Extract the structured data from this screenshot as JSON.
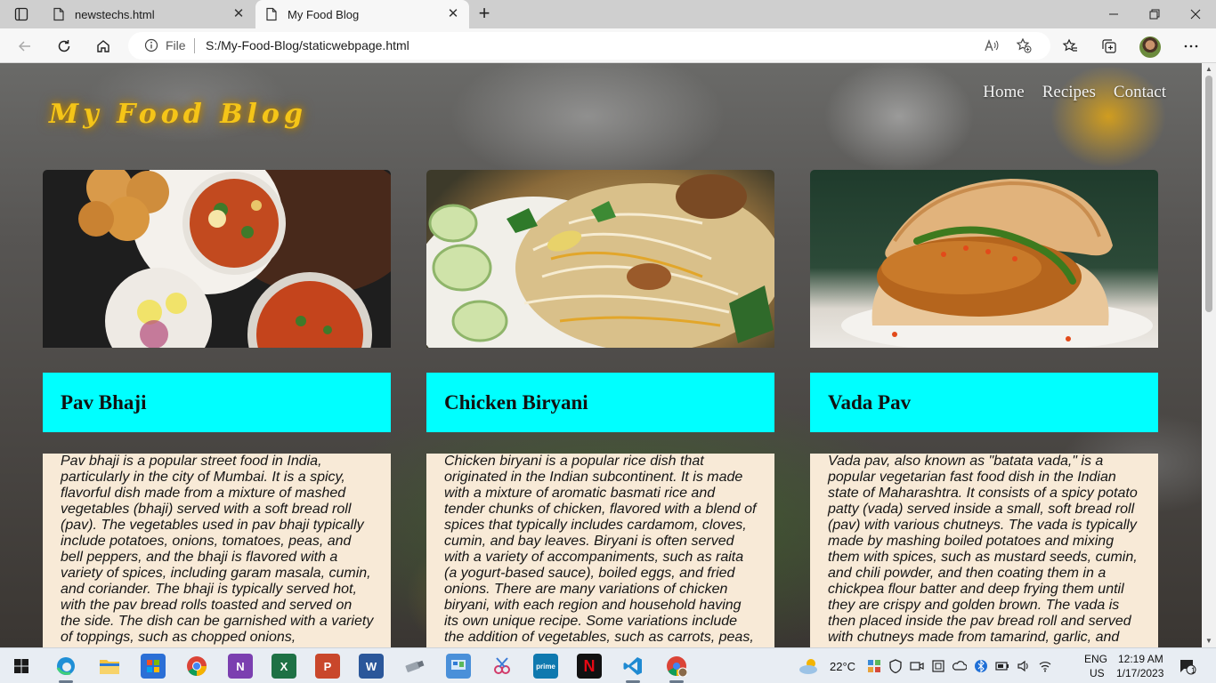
{
  "browser": {
    "tabs": [
      {
        "title": "newstechs.html",
        "active": false
      },
      {
        "title": "My Food Blog",
        "active": true
      }
    ],
    "address": {
      "scheme_label": "File",
      "url": "S:/My-Food-Blog/staticwebpage.html"
    }
  },
  "site": {
    "logo": "My Food Blog",
    "nav": [
      "Home",
      "Recipes",
      "Contact"
    ],
    "cards": [
      {
        "title": "Pav Bhaji",
        "description": "Pav bhaji is a popular street food in India, particularly in the city of Mumbai. It is a spicy, flavorful dish made from a mixture of mashed vegetables (bhaji) served with a soft bread roll (pav). The vegetables used in pav bhaji typically include potatoes, onions, tomatoes, peas, and bell peppers, and the bhaji is flavored with a variety of spices, including garam masala, cumin, and coriander. The bhaji is typically served hot, with the pav bread rolls toasted and served on the side. The dish can be garnished with a variety of toppings, such as chopped onions,"
      },
      {
        "title": "Chicken Biryani",
        "description": "Chicken biryani is a popular rice dish that originated in the Indian subcontinent. It is made with a mixture of aromatic basmati rice and tender chunks of chicken, flavored with a blend of spices that typically includes cardamom, cloves, cumin, and bay leaves. Biryani is often served with a variety of accompaniments, such as raita (a yogurt-based sauce), boiled eggs, and fried onions. There are many variations of chicken biryani, with each region and household having its own unique recipe. Some variations include the addition of vegetables, such as carrots, peas,"
      },
      {
        "title": "Vada Pav",
        "description": "Vada pav, also known as \"batata vada,\" is a popular vegetarian fast food dish in the Indian state of Maharashtra. It consists of a spicy potato patty (vada) served inside a small, soft bread roll (pav) with various chutneys. The vada is typically made by mashing boiled potatoes and mixing them with spices, such as mustard seeds, cumin, and chili powder, and then coating them in a chickpea flour batter and deep frying them until they are crispy and golden brown. The vada is then placed inside the pav bread roll and served with chutneys made from tamarind, garlic, and"
      }
    ]
  },
  "taskbar": {
    "weather": "22°C",
    "language": "ENG",
    "region": "US",
    "time": "12:19 AM",
    "date": "1/17/2023",
    "notifications": "1"
  },
  "colors": {
    "logo": "#f5c518",
    "card_title_bg": "#00ffff",
    "card_desc_bg": "#f8ead7"
  }
}
